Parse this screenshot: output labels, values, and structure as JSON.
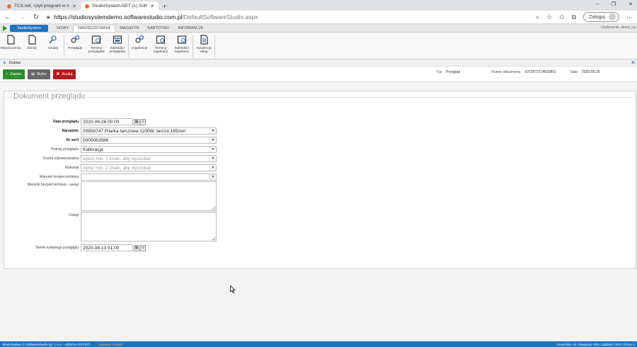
{
  "browser": {
    "tabs": [
      {
        "title": "TCS.net, czyli program w narzę..."
      },
      {
        "title": "StudioSystem.NET (c) SoftwareSt..."
      }
    ],
    "new_tab": "+",
    "window_controls": {
      "minimize": "–",
      "restore": "❐",
      "close": "✕"
    },
    "url_host": "https://studiosystemdemo.softwarestudio.com.pl",
    "url_path": "/DefaultSoftwareStudio.aspx",
    "login_label": "Zaloguj",
    "more": "···"
  },
  "app": {
    "brand": "StudioSystem",
    "menu": [
      "NOWY",
      "NARZĘDZIOWNIA",
      "MAGAZYN",
      "KARTOTEKI",
      "INFORMACJE"
    ],
    "active_menu": "NARZĘDZIOWNIA",
    "user_label": "Użytkownik: demo_na"
  },
  "ribbon": {
    "groups": [
      [
        {
          "label": "Wypożyczenia",
          "icon": "document-icon"
        },
        {
          "label": "Zwroty",
          "icon": "document-icon"
        },
        {
          "label": "Szukaj",
          "icon": "search-tools-icon"
        }
      ],
      [
        {
          "label": "Przeglądy",
          "icon": "gears-icon"
        },
        {
          "label": "Terminy przeglądów",
          "icon": "schedule-icon"
        },
        {
          "label": "Kalendarz przeglądów",
          "icon": "calendar-icon"
        }
      ],
      [
        {
          "label": "Legalizacje",
          "icon": "gears-icon"
        },
        {
          "label": "Terminy legalizacji",
          "icon": "schedule-icon"
        },
        {
          "label": "Kalendarz legalizacji",
          "icon": "calendar-icon"
        }
      ],
      [
        {
          "label": "Ewidencja usług",
          "icon": "document-list-icon"
        }
      ]
    ]
  },
  "dopisz": {
    "label": "Dopisz",
    "close": "✕"
  },
  "actions": {
    "save": "Zapisz",
    "draft": "Bufor",
    "cancel": "Anuluj"
  },
  "docinfo": {
    "type_label": "Typ",
    "type_value": "Przegląd",
    "number_label": "Numer dokumentu",
    "number_value": "6372872714693801",
    "date_label": "Data",
    "date_value": "2020-06-26"
  },
  "form": {
    "legend": "Dokument przeglądu",
    "fields": {
      "data_przegladu": {
        "label": "Data przeglądu",
        "value": "2020-06-26 00:00"
      },
      "narzedzie": {
        "label": "Narzędzie",
        "value": "00858747 Pilarka tarczowa 1200W, tarcza 185mm"
      },
      "nr_seri": {
        "label": "Nr serii",
        "value": "0005063586"
      },
      "rodzaj": {
        "label": "Rodzaj przeglądu",
        "value": "Kalibracja"
      },
      "osoba": {
        "label": "Osoba odpowiedzialna",
        "placeholder": "wpisz min. 2 znaki, aby wyszukać"
      },
      "wykonal": {
        "label": "Wykonał",
        "placeholder": "wpisz min. 2 znaki, aby wyszukać"
      },
      "warunki": {
        "label": "Warunki bezpieczeństwa",
        "value": ""
      },
      "warunki_uwagi": {
        "label": "Warunki bezpieczeństwa - uwagi"
      },
      "uwagi": {
        "label": "Uwagi"
      },
      "termin": {
        "label": "Termin kolejnego przeglądu",
        "value": "2020-08-13 01:00"
      }
    }
  },
  "statusbar": {
    "left": "StudioSystem © SoftwareStudio Sp. z o.o. - v2020.6.173.7477",
    "license": "Licencja: CURR?",
    "right": "| Komórka: 01 | Magazyn: MN | Oddział: CEN | Firma: 0"
  }
}
